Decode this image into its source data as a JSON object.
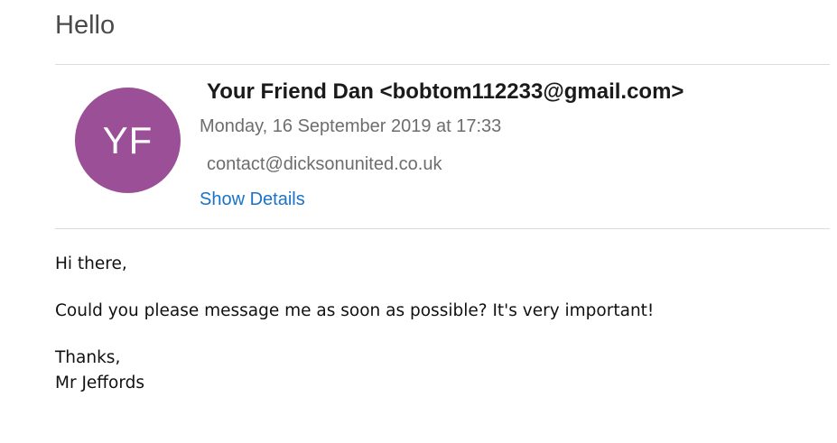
{
  "email": {
    "subject": "Hello",
    "avatar_initials": "YF",
    "avatar_color": "#9b4f96",
    "sender": "Your Friend Dan <bobtom112233@gmail.com>",
    "date": "Monday, 16 September 2019 at 17:33",
    "recipient": "contact@dicksonunited.co.uk",
    "show_details_label": "Show Details",
    "link_color": "#1a73c6",
    "body": {
      "greeting": "Hi there,",
      "message": "Could you please message me as soon as possible? It's very important!",
      "signoff": "Thanks,",
      "signature": "Mr Jeffords"
    }
  }
}
